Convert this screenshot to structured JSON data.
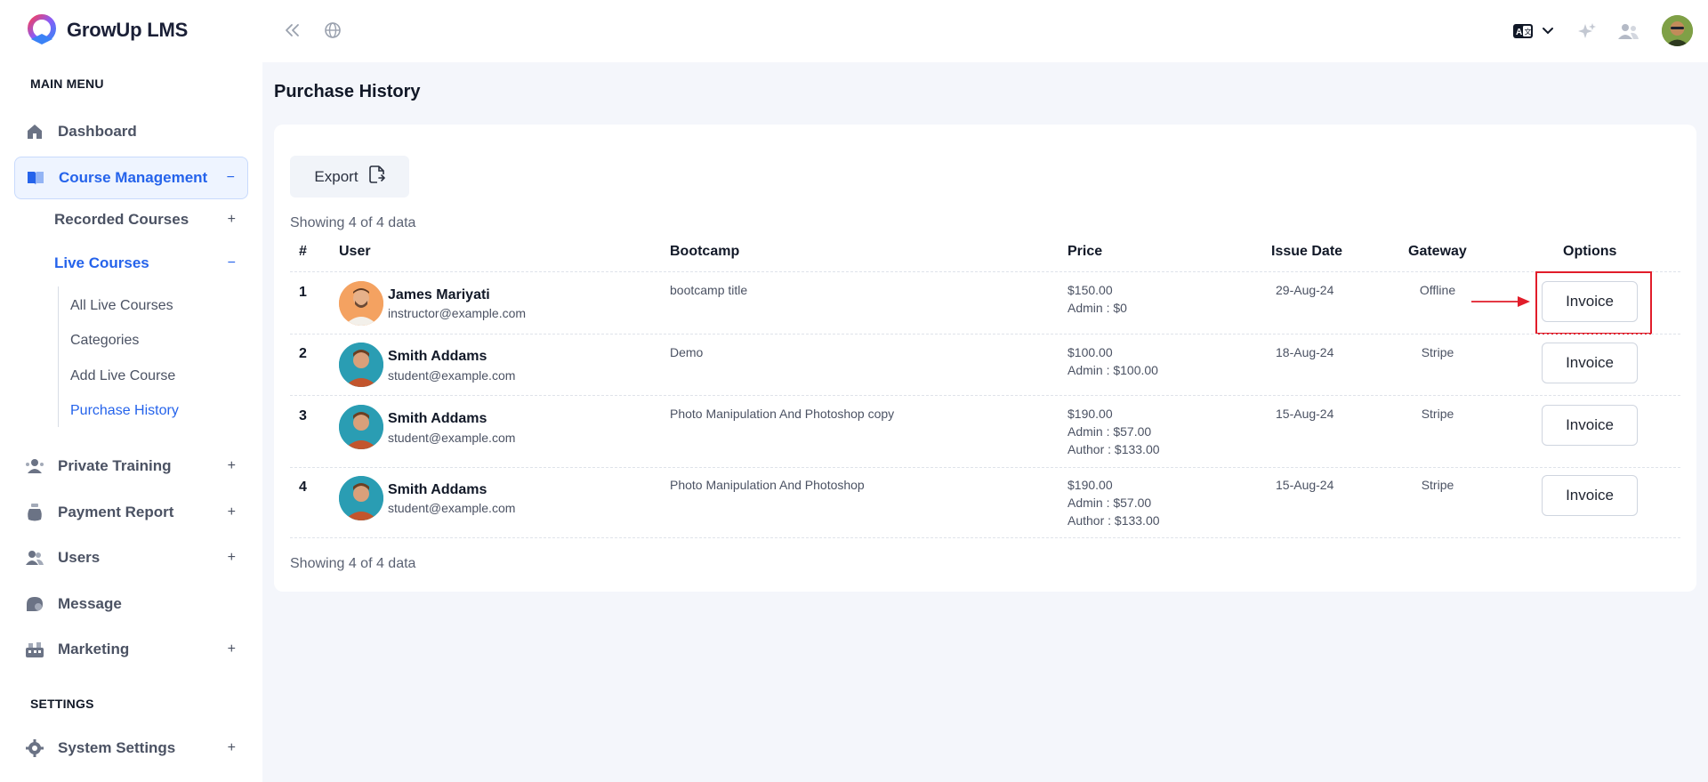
{
  "brand": {
    "name": "GrowUp LMS"
  },
  "sidebar": {
    "main_menu_label": "MAIN MENU",
    "settings_label": "SETTINGS",
    "dashboard": "Dashboard",
    "course_management": {
      "label": "Course Management",
      "toggle": "−"
    },
    "recorded_courses": {
      "label": "Recorded Courses",
      "toggle": "+"
    },
    "live_courses": {
      "label": "Live Courses",
      "toggle": "−"
    },
    "live_sub": [
      "All Live Courses",
      "Categories",
      "Add Live Course",
      "Purchase History"
    ],
    "private_training": {
      "label": "Private Training",
      "toggle": "+"
    },
    "payment_report": {
      "label": "Payment Report",
      "toggle": "+"
    },
    "users": {
      "label": "Users",
      "toggle": "+"
    },
    "message": "Message",
    "marketing": {
      "label": "Marketing",
      "toggle": "+"
    },
    "system_settings": {
      "label": "System Settings",
      "toggle": "+"
    }
  },
  "topbar": {
    "icons": [
      "collapse-sidebar-icon",
      "globe-icon",
      "language-icon",
      "chevron-down-icon",
      "sparkle-icon",
      "user-switch-icon",
      "avatar"
    ]
  },
  "page": {
    "title": "Purchase History",
    "export_label": "Export",
    "showing_top": "Showing 4 of 4 data",
    "showing_bottom": "Showing 4 of 4 data",
    "columns": [
      "#",
      "User",
      "Bootcamp",
      "Price",
      "Issue Date",
      "Gateway",
      "Options"
    ],
    "rows": [
      {
        "num": "1",
        "name": "James Mariyati",
        "email": "instructor@example.com",
        "bootcamp": "bootcamp title",
        "price": [
          "$150.00",
          "Admin : $0"
        ],
        "date": "29-Aug-24",
        "gateway": "Offline",
        "option": "Invoice"
      },
      {
        "num": "2",
        "name": "Smith Addams",
        "email": "student@example.com",
        "bootcamp": "Demo",
        "price": [
          "$100.00",
          "Admin : $100.00"
        ],
        "date": "18-Aug-24",
        "gateway": "Stripe",
        "option": "Invoice"
      },
      {
        "num": "3",
        "name": "Smith Addams",
        "email": "student@example.com",
        "bootcamp": "Photo Manipulation And Photoshop copy",
        "price": [
          "$190.00",
          "Admin : $57.00",
          "Author : $133.00"
        ],
        "date": "15-Aug-24",
        "gateway": "Stripe",
        "option": "Invoice"
      },
      {
        "num": "4",
        "name": "Smith Addams",
        "email": "student@example.com",
        "bootcamp": "Photo Manipulation And Photoshop",
        "price": [
          "$190.00",
          "Admin : $57.00",
          "Author : $133.00"
        ],
        "date": "15-Aug-24",
        "gateway": "Stripe",
        "option": "Invoice"
      }
    ]
  },
  "colors": {
    "accent": "#2563eb",
    "highlight": "#e11d2a",
    "background": "#f4f6fb"
  }
}
